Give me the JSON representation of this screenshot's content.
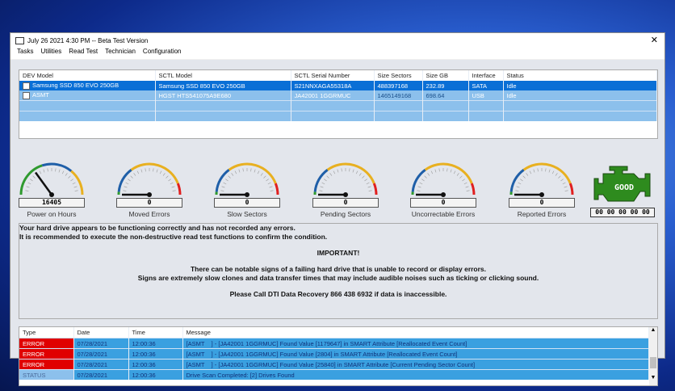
{
  "window": {
    "title": "July 26 2021 4:30 PM -- Beta Test Version",
    "close": "✕"
  },
  "menu": [
    "Tasks",
    "Utilities",
    "Read Test",
    "Technician",
    "Configuration"
  ],
  "drives": {
    "headers": [
      "DEV Model",
      "SCTL Model",
      "SCTL Serial Number",
      "Size Sectors",
      "Size GB",
      "Interface",
      "Status"
    ],
    "rows": [
      [
        "Samsung SSD 850 EVO 250GB",
        "Samsung SSD 850 EVO 250GB",
        "S21NNXAGA55318A",
        "488397168",
        "232.89",
        "SATA",
        "Idle"
      ],
      [
        "ASMT",
        "HGST HTS541075A9E680",
        "JA42001 1GGRMUC",
        "1465149168",
        "698.64",
        "USB",
        "Idle"
      ]
    ]
  },
  "gauges": [
    {
      "label": "Power on Hours",
      "value": "16405",
      "fraction": 0.3
    },
    {
      "label": "Moved Errors",
      "value": "0",
      "fraction": 0
    },
    {
      "label": "Slow Sectors",
      "value": "0",
      "fraction": 0
    },
    {
      "label": "Pending Sectors",
      "value": "0",
      "fraction": 0
    },
    {
      "label": "Uncorrectable Errors",
      "value": "0",
      "fraction": 0
    },
    {
      "label": "Reported Errors",
      "value": "0",
      "fraction": 0
    }
  ],
  "status": {
    "badge": "GOOD",
    "code": "00 00 00 00 00",
    "color": "#2e8b1e"
  },
  "message": {
    "line1": "Your hard drive appears to be functioning correctly and has not recorded any errors.",
    "line2": "It is recommended to execute the non-destructive read test functions to confirm the condition.",
    "important": "IMPORTANT!",
    "line3": "There can be notable signs of a failing hard drive that is unable to record or display errors.",
    "line4": "Signs are extremely slow clones and data transfer times that may include audible noises such as ticking or clicking sound.",
    "line5": "Please Call DTI Data Recovery 866 438 6932 if data is inaccessible."
  },
  "log": {
    "headers": [
      "Type",
      "Date",
      "Time",
      "Message"
    ],
    "rows": [
      [
        "ERROR",
        "07/28/2021",
        "12:00:36",
        "[ASMT    ] - [JA42001 1GGRMUC] Found Value [1179647] in SMART Attribute [Reallocated Event Count]"
      ],
      [
        "ERROR",
        "07/28/2021",
        "12:00:36",
        "[ASMT    ] - [JA42001 1GGRMUC] Found Value [2804] in SMART Attribute [Reallocated Event Count]"
      ],
      [
        "ERROR",
        "07/28/2021",
        "12:00:36",
        "[ASMT    ] - [JA42001 1GGRMUC] Found Value [25840] in SMART Attribute [Current Pending Sector Count]"
      ],
      [
        "STATUS",
        "07/28/2021",
        "12:00:36",
        "Drive Scan Completed: [2] Drives Found"
      ]
    ]
  }
}
